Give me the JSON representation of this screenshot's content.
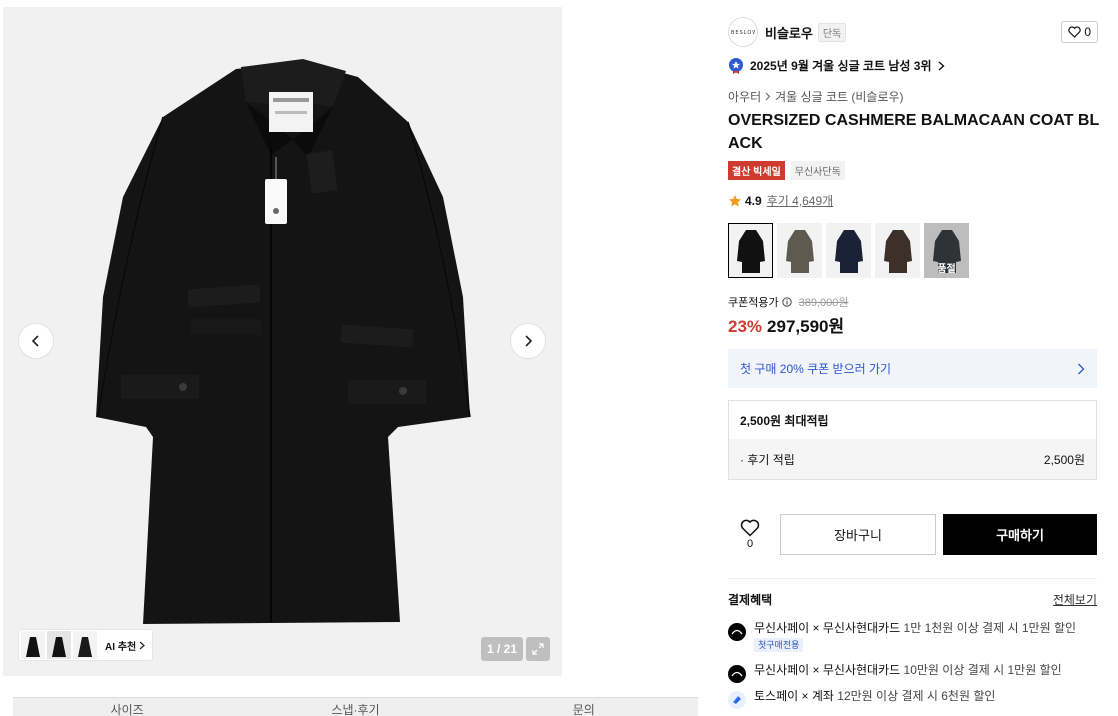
{
  "gallery": {
    "counter": "1 / 21",
    "ai_label": "AI 추천"
  },
  "tabs": [
    "사이즈",
    "스냅·후기",
    "문의"
  ],
  "brand": {
    "name": "비슬로우",
    "badge": "단독",
    "logo_text": "BESLOW",
    "like_count": "0"
  },
  "rank": "2025년 9월 겨울 싱글 코트 남성 3위",
  "breadcrumb": [
    "아우터",
    "겨울 싱글 코트 (비슬로우)"
  ],
  "product": {
    "title": "OVERSIZED CASHMERE BALMACAAN COAT BLACK",
    "tags": [
      "결산 빅세일",
      "무신사단독"
    ],
    "rating": "4.9",
    "review_text": "후기 4,649개"
  },
  "swatches": [
    {
      "color": "#111111",
      "selected": true
    },
    {
      "color": "#5f5a50"
    },
    {
      "color": "#1b2236"
    },
    {
      "color": "#3d3028"
    },
    {
      "color": "#2f3336",
      "soldout": true,
      "label": "품절"
    }
  ],
  "price": {
    "label": "쿠폰적용가",
    "original": "389,000원",
    "discount": "23%",
    "final": "297,590원"
  },
  "coupon": "첫 구매 20% 쿠폰 받으러 가기",
  "points": {
    "title": "2,500원 최대적립",
    "row_label": "· 후기 적립",
    "row_value": "2,500원"
  },
  "actions": {
    "like_count": "0",
    "cart": "장바구니",
    "buy": "구매하기"
  },
  "benefits": {
    "title": "결제혜택",
    "view_all": "전체보기",
    "items": [
      {
        "name": "무신사페이 × 무신사현대카드",
        "desc": "1만 1천원 이상 결제 시 1만원 할인",
        "tag": "첫구매전용"
      },
      {
        "name": "무신사페이 × 무신사현대카드",
        "desc": "10만원 이상 결제 시 1만원 할인"
      },
      {
        "name": "토스페이 × 계좌",
        "desc": "12만원 이상 결제 시 6천원 할인"
      }
    ]
  },
  "colors": {
    "accent_red": "#d03b2f",
    "link_blue": "#2c56c9",
    "buy_button": "#000000"
  }
}
